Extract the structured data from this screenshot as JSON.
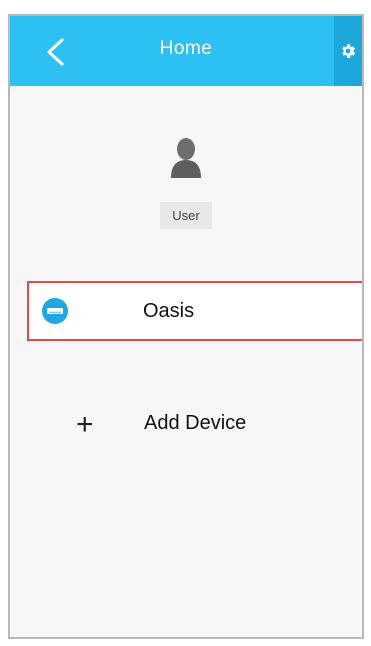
{
  "header": {
    "title": "Home",
    "back_icon": "chevron-left-icon",
    "settings_icon": "gear-icon"
  },
  "user": {
    "label": "User",
    "avatar_icon": "user-silhouette-icon"
  },
  "devices": [
    {
      "name": "Oasis",
      "icon": "ac-unit-icon",
      "selected": true
    }
  ],
  "actions": {
    "add_device_symbol": "+",
    "add_device_label": "Add Device"
  },
  "colors": {
    "header_bg": "#2dc0f2",
    "header_accent": "#1ca8db",
    "device_icon": "#1ea7e0",
    "selection_border": "#e44b4b"
  }
}
